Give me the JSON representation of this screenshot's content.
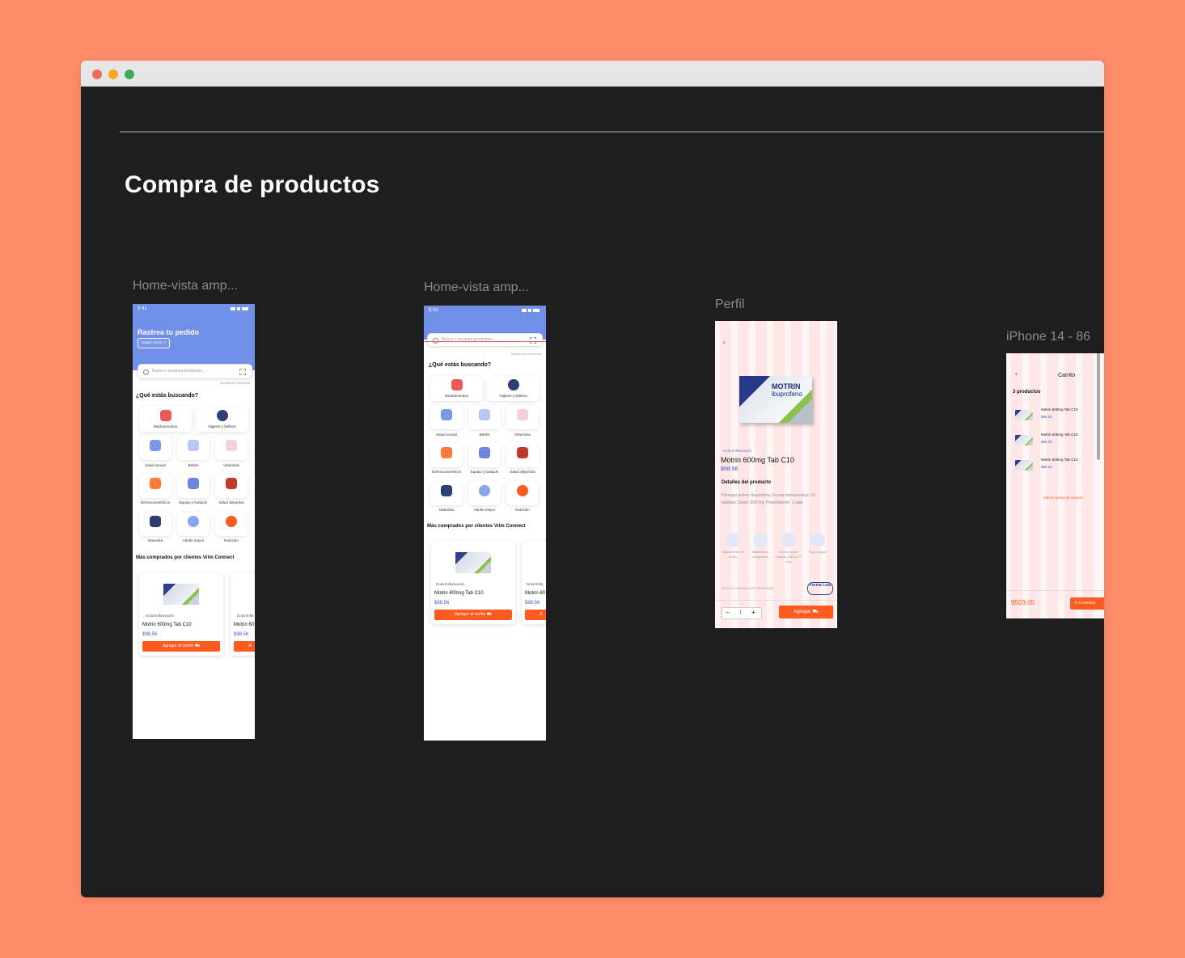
{
  "window": {
    "section_title": "Compra de productos"
  },
  "frames": {
    "frame1": {
      "label": "Home-vista amp...",
      "time": "9:41",
      "header_title": "Rastrea tu pedido",
      "track_button": "Seguir envío ↗",
      "search_placeholder": "Busca o escanea productos...",
      "pharmacy_note": "Operado por FarmaLeal",
      "question": "¿Qué estás buscando?",
      "categories": [
        "Medicamentos",
        "Higiene y belleza",
        "Salud sexual",
        "Bebés",
        "Vitaminas",
        "Dermocosméticos",
        "Equipo y botiquín",
        "Salud deportiva",
        "Naturista",
        "Adulto mayor",
        "Nutrición"
      ],
      "most_bought": "Más comprados por clientes Vrim Connect",
      "product_category": "Dolor/Inflamación",
      "product_name": "Motrin 600mg Tab C10",
      "product_price": "$98.56",
      "add_button": "Agregar al carrito",
      "partial_name": "Motrin 60",
      "partial_category": "Dolor/Infla",
      "partial_price": "$98.56",
      "partial_button": "A"
    },
    "frame2": {
      "label": "Home-vista amp...",
      "time": "9:41",
      "search_placeholder": "Busca o escanea productos...",
      "pharmacy_note": "Operado por FarmaLeal",
      "question": "¿Qué estás buscando?",
      "categories": [
        "Medicamentos",
        "Higiene y belleza",
        "Salud sexual",
        "Bebés",
        "Vitaminas",
        "Dermocosméticos",
        "Equipo y botiquín",
        "Salud deportiva",
        "Naturista",
        "Adulto mayor",
        "Nutrición"
      ],
      "most_bought": "Más comprados por clientes Vrim Connect",
      "product_category": "Dolor/Inflamación",
      "product_name": "Motrin 600mg Tab C10",
      "product_price": "$98.56",
      "add_button": "Agregar al carrito",
      "partial_name": "Motrin 60",
      "partial_category": "Dolor/Infla",
      "partial_price": "$98.56",
      "partial_button": "A"
    },
    "frame3": {
      "label": "Perfil",
      "box_brand": "MOTRIN",
      "box_sub": "ibuprofeno",
      "category": "Dolor/Inflamación",
      "product_name": "Motrin 600mg Tab C10",
      "price": "$98.56",
      "details_title": "Detalles del producto",
      "details_text": "Principio activo: Ibuprofeno; Forma farmacéutica: 10 tabletas; Dosis: 600 mg; Presentación: 1 caja",
      "features": [
        {
          "label": "Seguimiento de envío"
        },
        {
          "label": "Satisfacción asegurada"
        },
        {
          "label": "Envíos super rápidos (48hrs-72 hrs)"
        },
        {
          "label": "Pago seguro"
        }
      ],
      "service_note": "Servicio operado por FarmaLeal",
      "logo_text": "Farma Leal",
      "qty": "1",
      "minus": "−",
      "plus": "+",
      "add_button": "Agregar"
    },
    "frame4": {
      "label": "iPhone 14 - 86",
      "title": "Carrito",
      "count": "3 productos",
      "items": [
        {
          "name": "Motrin 600mg Tab C10",
          "price": "$96.34"
        },
        {
          "name": "Motrin 600mg Tab C10",
          "price": "$96.34"
        },
        {
          "name": "Motrin 600mg Tab C10",
          "price": "$96.34"
        }
      ],
      "empty_cart": "Vaciar carrito de compra",
      "total": "$503.05",
      "checkout_button": "Ir a compra"
    }
  },
  "colors": {
    "page_bg": "#FF8C69",
    "canvas_bg": "#1E1E1E",
    "header_blue": "#6F8FE8",
    "accent_orange": "#FF5A1F",
    "price_blue": "#3B5CC6"
  }
}
